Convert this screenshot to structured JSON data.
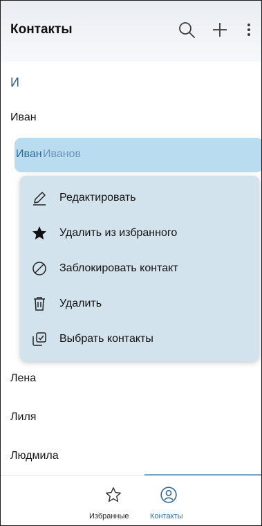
{
  "header": {
    "title": "Контакты",
    "icons": [
      "search-icon",
      "plus-icon",
      "more-vert-icon"
    ]
  },
  "list": {
    "section_letter": "И",
    "rows": [
      {
        "name": "Иван"
      },
      {
        "first": "Иван",
        "last": "Иванов",
        "selected": true
      },
      {
        "name": "Лена"
      },
      {
        "name": "Лиля"
      },
      {
        "name": "Людмила"
      }
    ]
  },
  "context_menu": {
    "items": [
      {
        "label": "Редактировать",
        "icon": "pencil-icon"
      },
      {
        "label": "Удалить из избранного",
        "icon": "star-filled-icon"
      },
      {
        "label": "Заблокировать контакт",
        "icon": "block-icon"
      },
      {
        "label": "Удалить",
        "icon": "trash-icon"
      },
      {
        "label": "Выбрать контакты",
        "icon": "select-contacts-icon"
      }
    ]
  },
  "bottom_nav": {
    "tabs": [
      {
        "label": "Избранные",
        "icon": "star-outline-icon",
        "active": false
      },
      {
        "label": "Контакты",
        "icon": "contact-circle-icon",
        "active": true
      }
    ]
  },
  "colors": {
    "accent": "#2e6a9a",
    "selection": "#b9dcf0",
    "menu_bg": "#d3e3ed"
  }
}
